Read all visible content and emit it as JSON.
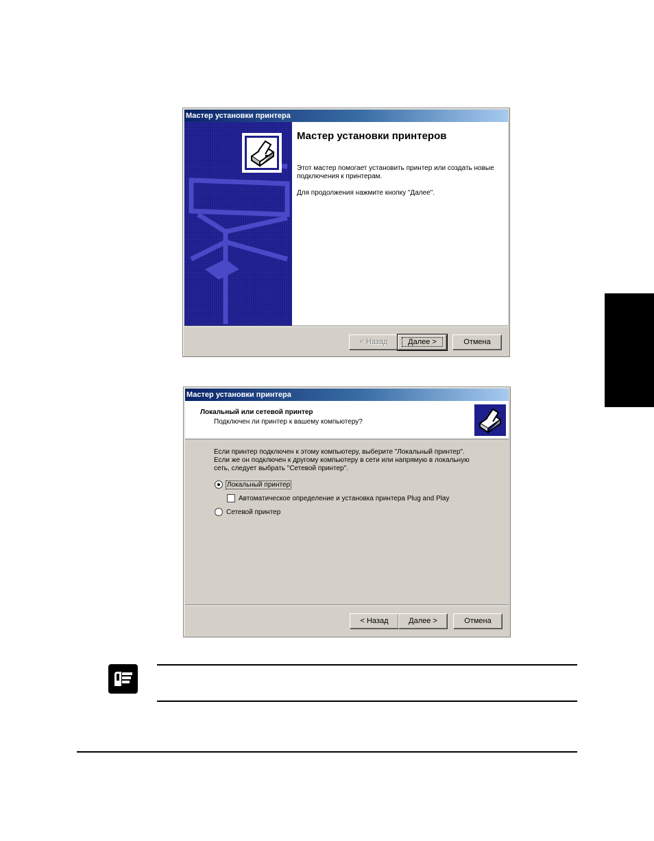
{
  "dialog1": {
    "title": "Мастер установки принтера",
    "heading": "Мастер установки принтеров",
    "para1": "Этот мастер помогает установить принтер или создать новые подключения к принтерам.",
    "para2": "Для продолжения нажмите кнопку \"Далее\".",
    "back_label": "< Назад",
    "next_label": "Далее >",
    "cancel_label": "Отмена"
  },
  "dialog2": {
    "title": "Мастер установки принтера",
    "header_title": "Локальный или сетевой принтер",
    "header_subtitle": "Подключен ли принтер к вашему компьютеру?",
    "body_line1": "Если принтер подключен к этому компьютеру, выберите \"Локальный принтер\".",
    "body_line2": "Если же он подключен к другому компьютеру в сети или напрямую в локальную",
    "body_line3": "сеть, следует выбрать \"Сетевой принтер\".",
    "radio_local_label": "Локальный принтер",
    "radio_local_checked": true,
    "checkbox_pnp_label": "Автоматическое определение и установка принтера Plug and Play",
    "checkbox_pnp_checked": false,
    "radio_network_label": "Сетевой принтер",
    "radio_network_checked": false,
    "back_label": "< Назад",
    "next_label": "Далее >",
    "cancel_label": "Отмена"
  },
  "icons": {
    "wizard_printer": "printer-icon",
    "header_printer": "printer-icon",
    "note": "pointing-hand-icon"
  },
  "colors": {
    "titlebar_start": "#0a246a",
    "titlebar_end": "#a6caf0",
    "wizard_banner": "#1e1e8c",
    "dialog_face": "#d4d0c8",
    "side_tab": "#000000"
  }
}
